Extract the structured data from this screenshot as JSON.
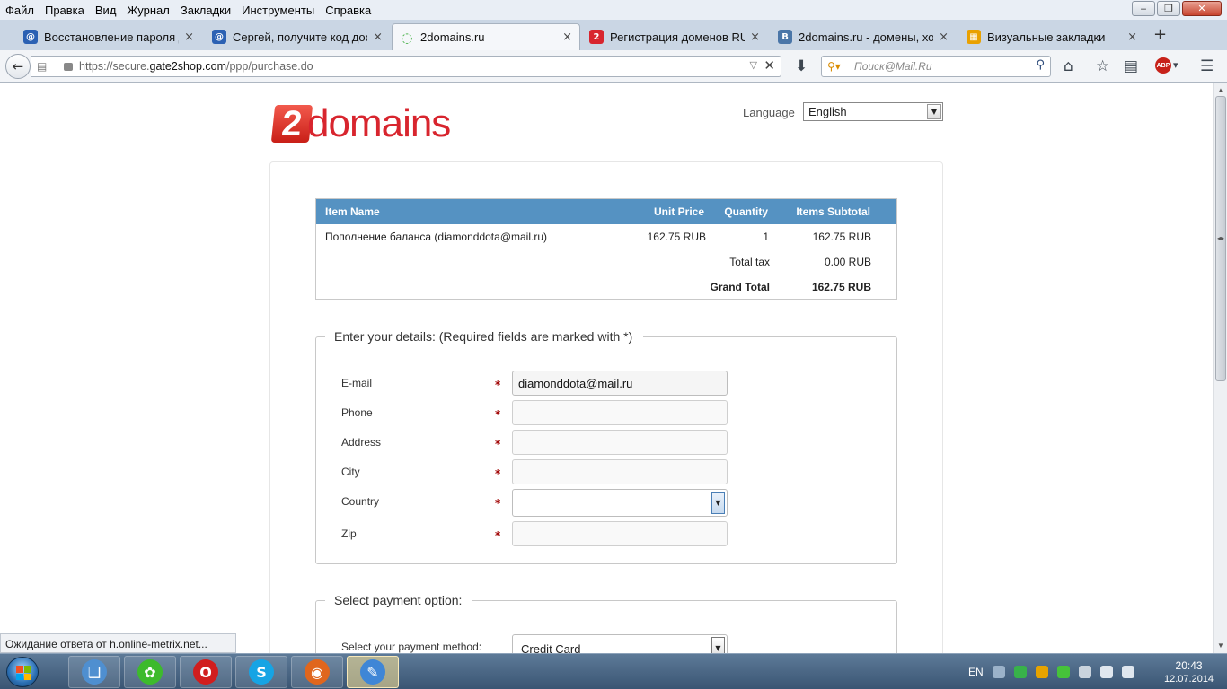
{
  "menu": [
    "Файл",
    "Правка",
    "Вид",
    "Журнал",
    "Закладки",
    "Инструменты",
    "Справка"
  ],
  "window_buttons": {
    "minimize": "‒",
    "maximize": "❐",
    "close": "✕"
  },
  "tabs": [
    {
      "title": "Восстановление пароля д...",
      "icon": "mail-ru-icon",
      "color": "#2b61b3",
      "glyph": "@"
    },
    {
      "title": "Сергей, получите код дос...",
      "icon": "mail-ru-icon",
      "color": "#2b61b3",
      "glyph": "@"
    },
    {
      "title": "2domains.ru",
      "icon": "loading-spinner-icon",
      "color": "#3fae3f",
      "glyph": "◌",
      "active": true
    },
    {
      "title": "Регистрация доменов RU ...",
      "icon": "2domains-icon",
      "color": "#d8252e",
      "glyph": "2"
    },
    {
      "title": "2domains.ru - домены, хо...",
      "icon": "vk-icon",
      "color": "#4a76a8",
      "glyph": "B"
    },
    {
      "title": "Визуальные закладки",
      "icon": "visual-bookmarks-icon",
      "color": "#e9a100",
      "glyph": "▦"
    }
  ],
  "tab_close": "×",
  "new_tab": "+",
  "nav": {
    "url_prefix": "https://secure.",
    "url_host": "gate2shop.com",
    "url_path": "/ppp/purchase.do",
    "search_placeholder": "Поиск@Mail.Ru"
  },
  "page": {
    "logo": {
      "digit": "2",
      "word": "domains"
    },
    "language_label": "Language",
    "language_value": "English",
    "cart": {
      "headers": [
        "Item Name",
        "Unit Price",
        "Quantity",
        "Items Subtotal"
      ],
      "rows": [
        {
          "name": "Пополнение баланса (diamonddota@mail.ru)",
          "unit_price": "162.75 RUB",
          "quantity": "1",
          "subtotal": "162.75 RUB"
        }
      ],
      "tax_label": "Total tax",
      "tax_value": "0.00 RUB",
      "grand_total_label": "Grand Total",
      "grand_total_value": "162.75 RUB"
    },
    "details": {
      "legend": "Enter your details: (Required fields are marked with *)",
      "required_mark": "*",
      "fields": [
        {
          "label": "E-mail",
          "value": "diamonddota@mail.ru"
        },
        {
          "label": "Phone",
          "value": ""
        },
        {
          "label": "Address",
          "value": ""
        },
        {
          "label": "City",
          "value": ""
        },
        {
          "label": "Country",
          "value": ""
        },
        {
          "label": "Zip",
          "value": ""
        }
      ]
    },
    "payment": {
      "legend": "Select payment option:",
      "method_label": "Select your payment method:",
      "method_value": "Credit Card"
    }
  },
  "status_text": "Ожидание ответа от h.online-metrix.net...",
  "taskbar": {
    "apps": [
      {
        "name": "windows-explorer",
        "glyph": "❑",
        "color": "#4f8fd0"
      },
      {
        "name": "icq",
        "glyph": "✿",
        "color": "#3dba2c"
      },
      {
        "name": "opera",
        "glyph": "O",
        "color": "#d11e1e"
      },
      {
        "name": "skype",
        "glyph": "S",
        "color": "#16a4e4"
      },
      {
        "name": "firefox",
        "glyph": "◉",
        "color": "#e0661d"
      },
      {
        "name": "paint",
        "glyph": "✎",
        "color": "#3f86d6"
      }
    ],
    "lang": "EN",
    "time": "20:43",
    "date": "12.07.2014"
  }
}
